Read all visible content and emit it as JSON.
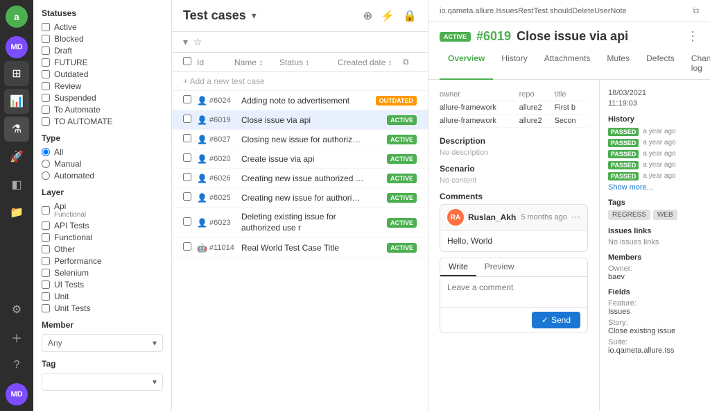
{
  "nav": {
    "logo": "a",
    "avatar": "MD",
    "icons": [
      "grid",
      "chart",
      "flask",
      "rocket",
      "layers",
      "folder",
      "gear",
      "plus",
      "question"
    ],
    "active_icon": "flask"
  },
  "sidebar": {
    "statuses_label": "Statuses",
    "statuses": [
      {
        "label": "Active",
        "checked": false
      },
      {
        "label": "Blocked",
        "checked": false
      },
      {
        "label": "Draft",
        "checked": false
      },
      {
        "label": "FUTURE",
        "checked": false
      },
      {
        "label": "Outdated",
        "checked": false
      },
      {
        "label": "Review",
        "checked": false
      },
      {
        "label": "Suspended",
        "checked": false
      },
      {
        "label": "To Automate",
        "checked": false
      },
      {
        "label": "TO AUTOMATE",
        "checked": false
      }
    ],
    "type_label": "Type",
    "types": [
      {
        "label": "All",
        "checked": true
      },
      {
        "label": "Manual",
        "checked": false
      },
      {
        "label": "Automated",
        "checked": false
      }
    ],
    "layer_label": "Layer",
    "layers": [
      {
        "label": "Api",
        "checked": false,
        "sublabel": "Functional"
      },
      {
        "label": "API Tests",
        "checked": false
      },
      {
        "label": "Functional",
        "checked": false
      },
      {
        "label": "Other",
        "checked": false
      },
      {
        "label": "Performance",
        "checked": false
      },
      {
        "label": "Selenium",
        "checked": false
      },
      {
        "label": "UI Tests",
        "checked": false
      },
      {
        "label": "Unit",
        "checked": false
      },
      {
        "label": "Unit Tests",
        "checked": false
      }
    ],
    "member_label": "Member",
    "member_placeholder": "Any",
    "tag_label": "Tag"
  },
  "test_cases": {
    "title": "Test cases",
    "columns": {
      "id": "Id",
      "name": "Name",
      "status": "Status",
      "created_date": "Created date"
    },
    "add_label": "+ Add a new test case",
    "rows": [
      {
        "id": "#6024",
        "name": "Adding note to advertisement",
        "status": "OUTDATED",
        "selected": false
      },
      {
        "id": "#6019",
        "name": "Close issue via api",
        "status": "ACTIVE",
        "selected": true
      },
      {
        "id": "#6027",
        "name": "Closing new issue for authorized user",
        "status": "ACTIVE",
        "selected": false
      },
      {
        "id": "#6020",
        "name": "Create issue via api",
        "status": "ACTIVE",
        "selected": false
      },
      {
        "id": "#6026",
        "name": "Creating new issue authorized user",
        "status": "ACTIVE",
        "selected": false
      },
      {
        "id": "#6025",
        "name": "Creating new issue for authorized user",
        "status": "ACTIVE",
        "selected": false
      },
      {
        "id": "#6023",
        "name": "Deleting existing issue for authorized user",
        "status": "ACTIVE",
        "selected": false
      },
      {
        "id": "#11014",
        "name": "Real World Test Case Title",
        "status": "ACTIVE",
        "selected": false
      }
    ]
  },
  "detail": {
    "breadcrumb": "io.qameta.allure.IssuesRestTest.shouldDeleteUserNote",
    "badge": "ACTIVE",
    "issue_id": "#6019",
    "title": "Close issue via api",
    "tabs": [
      "Overview",
      "History",
      "Attachments",
      "Mutes",
      "Defects",
      "Change log"
    ],
    "active_tab": "Overview",
    "table": {
      "headers": [
        "owner",
        "repo",
        "title"
      ],
      "rows": [
        {
          "owner": "allure-framework",
          "repo": "allure2",
          "title": "First b"
        },
        {
          "owner": "allure-framework",
          "repo": "allure2",
          "title": "Secon"
        }
      ]
    },
    "description_label": "Description",
    "description_value": "No description",
    "scenario_label": "Scenario",
    "scenario_value": "No content",
    "comments_label": "Comments",
    "comment": {
      "author": "Ruslan_Akh",
      "avatar_initials": "RA",
      "time": "5 months ago",
      "body": "Hello, World"
    },
    "editor": {
      "write_tab": "Write",
      "preview_tab": "Preview",
      "placeholder": "Leave a comment",
      "send_label": "Send"
    },
    "sidebar": {
      "date": "18/03/2021",
      "time": "11:19:03",
      "history_label": "History",
      "history_items": [
        "a year ago",
        "a year ago",
        "a year ago",
        "a year ago",
        "a year ago"
      ],
      "show_more": "Show more...",
      "tags_label": "Tags",
      "tags": [
        "REGRESS",
        "WEB"
      ],
      "issues_links_label": "Issues links",
      "issues_links_value": "No issues links",
      "members_label": "Members",
      "owner_label": "Owner:",
      "owner_value": "baev",
      "fields_label": "Fields",
      "fields": [
        {
          "key": "Feature:",
          "value": "Issues"
        },
        {
          "key": "Story:",
          "value": "Close existing issue"
        },
        {
          "key": "Suite:",
          "value": "io.qameta.allure.Iss"
        }
      ]
    }
  }
}
